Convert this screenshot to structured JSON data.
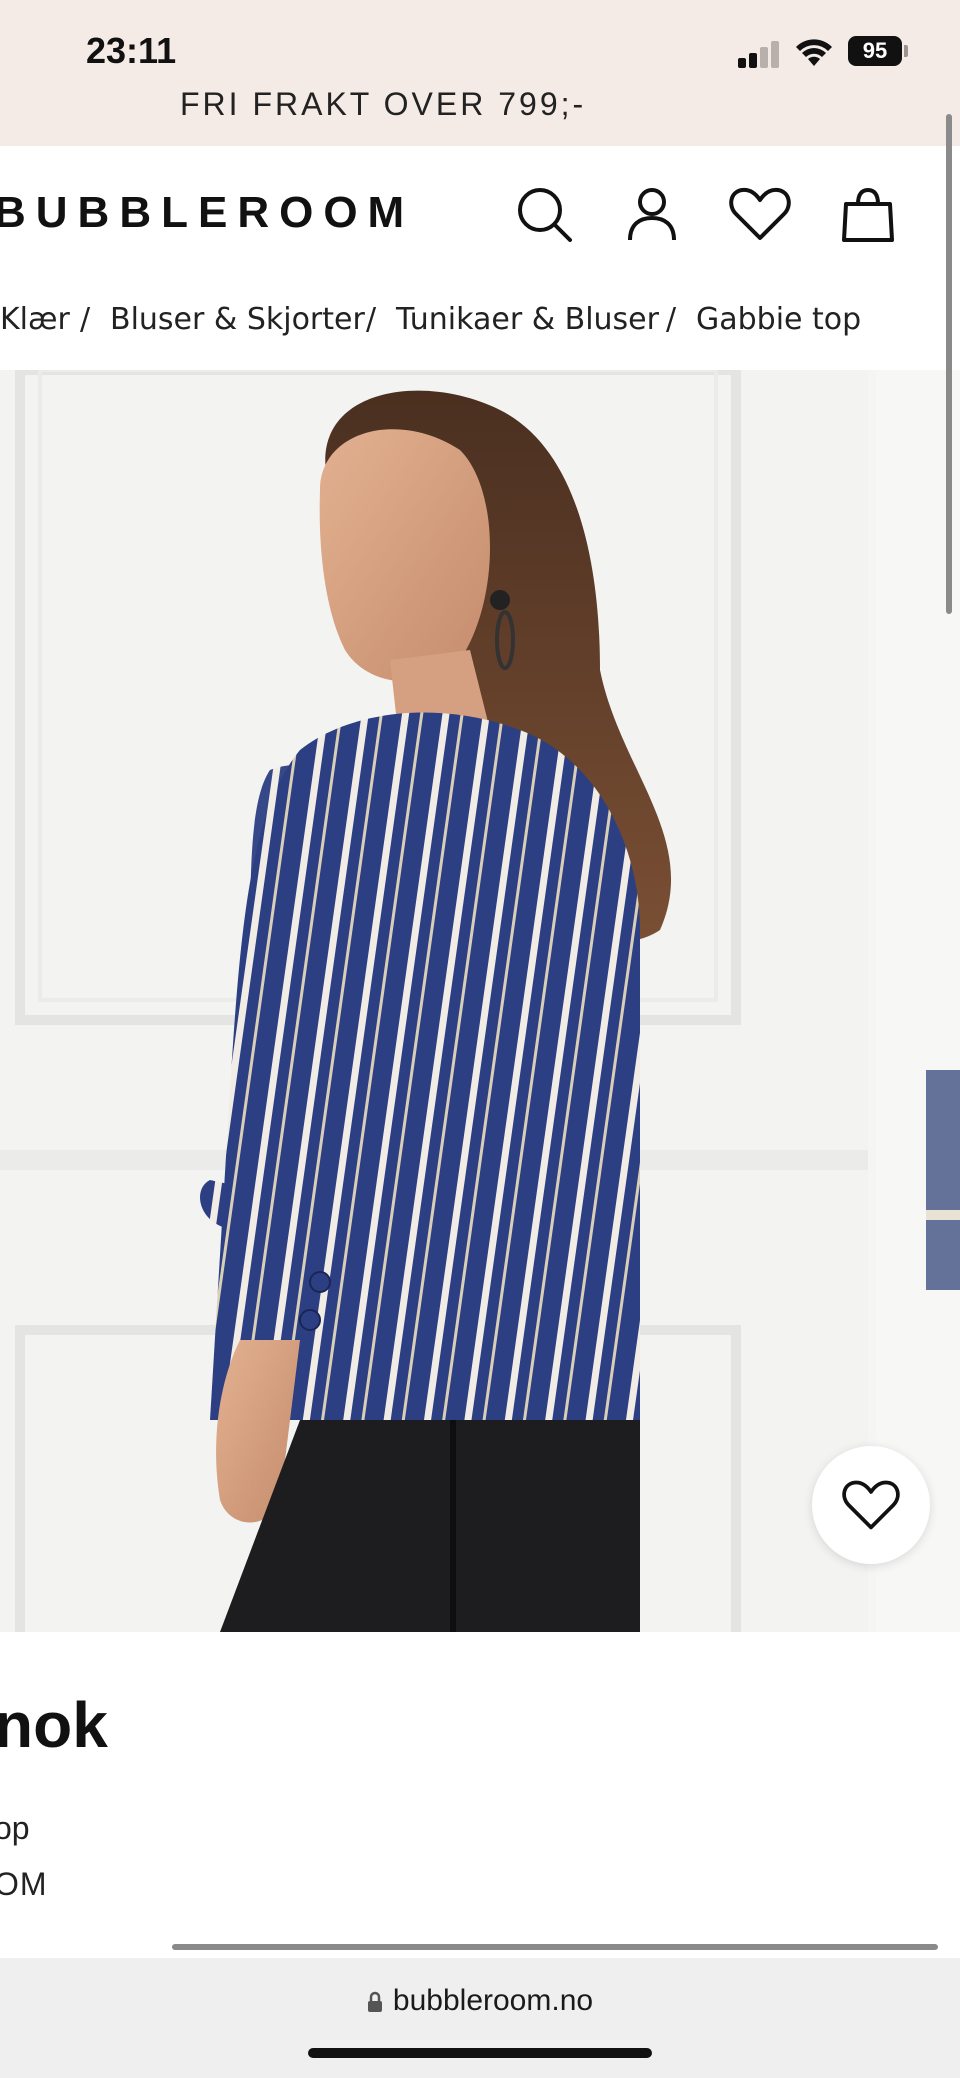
{
  "status_bar": {
    "time": "23:11",
    "battery": "95",
    "signal_icon": "cellular-signal-icon",
    "wifi_icon": "wifi-icon"
  },
  "promo": {
    "text": "FRI FRAKT OVER 799;-"
  },
  "header": {
    "logo": "BUBBLEROOM",
    "icons": [
      "search-icon",
      "account-icon",
      "wishlist-icon",
      "cart-icon"
    ]
  },
  "breadcrumb": {
    "items": [
      "Klær",
      "Bluser & Skjorter",
      "Tunikaer & Bluser",
      "Gabbie top"
    ],
    "separator": "/"
  },
  "gallery": {
    "image_description_icon": "product-photo",
    "wishlist_icon": "heart-icon"
  },
  "product": {
    "brand_title": "nok",
    "name": "op",
    "brand": "OM"
  },
  "browser": {
    "url": "bubbleroom.no"
  },
  "colors": {
    "status_bg": "#f4ebe6",
    "accent_blue": "#2c3f82"
  }
}
